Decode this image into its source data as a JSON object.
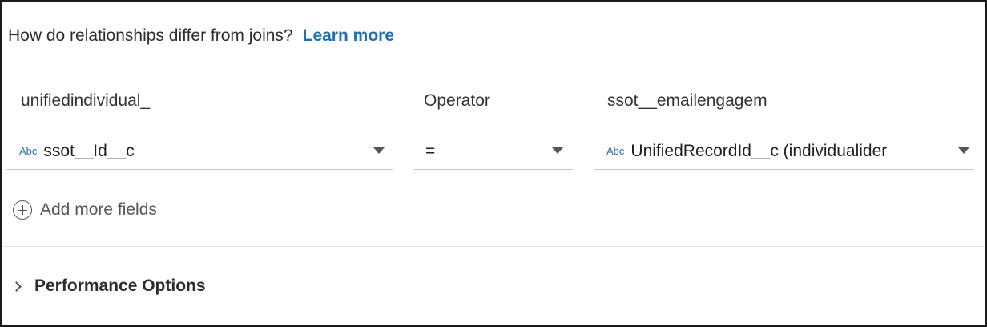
{
  "help": {
    "question": "How do relationships differ from joins?",
    "link_label": "Learn more"
  },
  "columns": {
    "left_header": "unifiedindividual_",
    "operator_header": "Operator",
    "right_header": "ssot__emailengagem"
  },
  "fields": {
    "left": {
      "type_badge": "Abc",
      "value": "ssot__Id__c"
    },
    "operator": {
      "value": "="
    },
    "right": {
      "type_badge": "Abc",
      "value": "UnifiedRecordId__c (individualider"
    }
  },
  "add_fields_label": "Add more fields",
  "performance_label": "Performance Options"
}
